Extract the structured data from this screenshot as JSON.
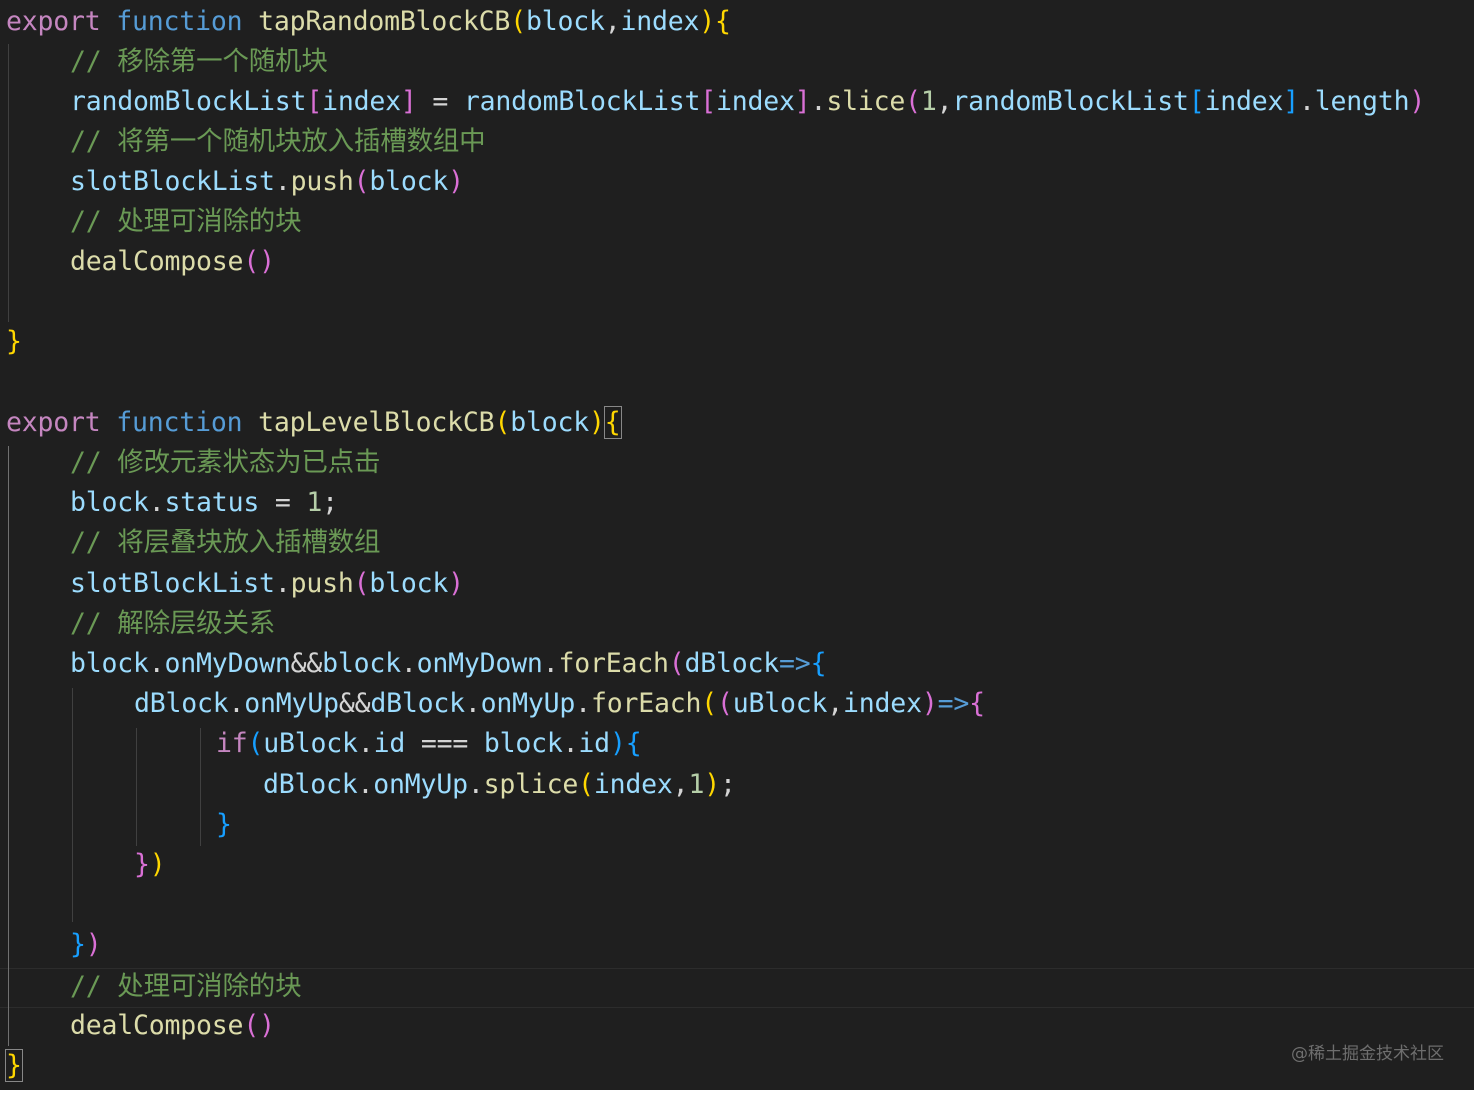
{
  "watermark": "@稀土掘金技术社区",
  "tokens": {
    "export": "export",
    "function": "function",
    "if": "if",
    "fn1_name": "tapRandomBlockCB",
    "fn2_name": "tapLevelBlockCB",
    "block": "block",
    "index": "index",
    "randomBlockList": "randomBlockList",
    "slotBlockList": "slotBlockList",
    "push": "push",
    "slice": "slice",
    "length": "length",
    "dealCompose": "dealCompose",
    "status": "status",
    "onMyDown": "onMyDown",
    "onMyUp": "onMyUp",
    "forEach": "forEach",
    "dBlock": "dBlock",
    "uBlock": "uBlock",
    "id": "id",
    "splice": "splice",
    "one": "1"
  },
  "comments": {
    "c1": "// 移除第一个随机块",
    "c2": "// 将第一个随机块放入插槽数组中",
    "c3": "// 处理可消除的块",
    "c4": "// 修改元素状态为已点击",
    "c5": "// 将层叠块放入插槽数组",
    "c6": "// 解除层级关系",
    "c7": "// 处理可消除的块"
  }
}
